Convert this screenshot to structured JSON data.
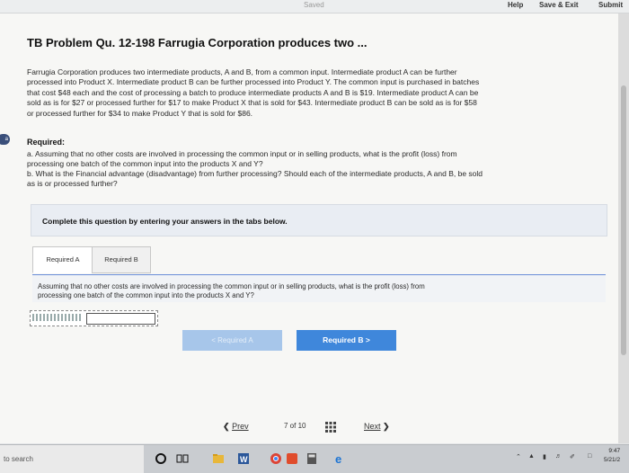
{
  "header": {
    "saved": "Saved",
    "help": "Help",
    "save_exit": "Save & Exit",
    "submit": "Submit"
  },
  "problem": {
    "title": "TB Problem Qu. 12-198 Farrugia Corporation produces two ...",
    "lines": [
      "Farrugia Corporation produces two intermediate products, A and B, from a common input. Intermediate product A can be further",
      "processed into Product X. Intermediate product B can be further processed into Product Y. The common input is purchased in batches",
      "that cost $48 each and the cost of processing a batch to produce intermediate products A and B is $19. Intermediate product A can be",
      "sold as is for $27 or processed further for $17 to make Product X that is sold for $43. Intermediate product B can be sold as is for $58",
      "or processed further for $34 to make Product Y that is sold for $86."
    ],
    "badge": "a"
  },
  "required": {
    "heading": "Required:",
    "lines": [
      "a. Assuming that no other costs are involved in processing the common input or in selling products, what is the profit (loss) from",
      "processing one batch of the common input into the products X and Y?",
      "b. What is the Financial advantage (disadvantage) from further processing? Should each of the intermediate products, A and B, be sold",
      "as is or processed further?"
    ]
  },
  "complete_banner": "Complete this question by entering your answers in the tabs below.",
  "tabs": [
    {
      "label": "Required A"
    },
    {
      "label": "Required B"
    }
  ],
  "question": {
    "line1": "Assuming that no other costs are involved in processing the common input or in selling products, what is the profit (loss) from",
    "line2": "processing one batch of the common input into the products X and Y?"
  },
  "buttons": {
    "prev_label": "< Required A",
    "next_label": "Required B  >"
  },
  "pager": {
    "prev": "Prev",
    "count": "7 of 10",
    "next": "Next"
  },
  "taskbar": {
    "search": "to search",
    "time": "9:47",
    "date": "5/21/2"
  },
  "colors": {
    "accent": "#3f87db",
    "accent_disabled": "#a7c6ea",
    "tab_line": "#6a8ed8"
  }
}
